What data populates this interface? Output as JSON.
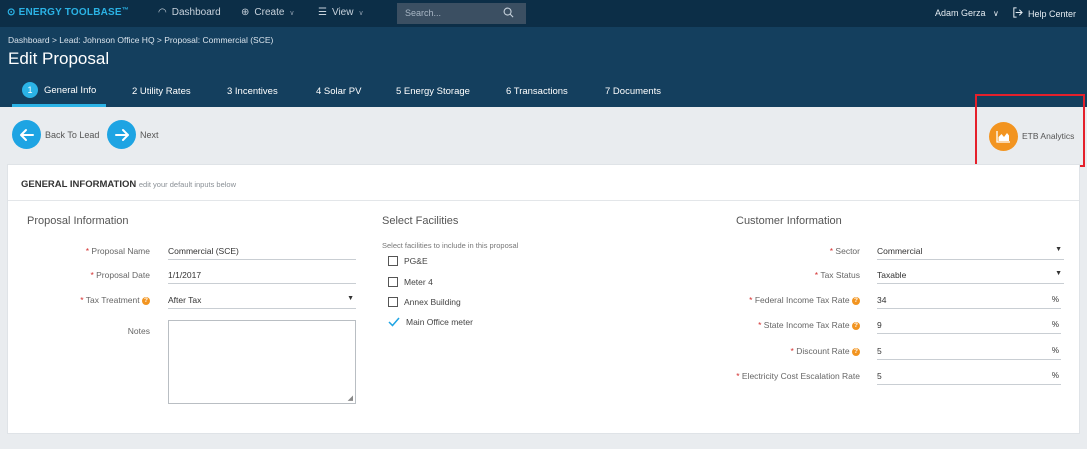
{
  "topnav": {
    "logo": "ENERGY TOOLBASE",
    "logo_tm": "™",
    "dashboard": "Dashboard",
    "create": "Create",
    "view": "View",
    "search_placeholder": "Search...",
    "user": "Adam Gerza",
    "help": "Help Center"
  },
  "header": {
    "breadcrumb": "Dashboard  >  Lead: Johnson Office HQ  >  Proposal: Commercial (SCE)",
    "title": "Edit Proposal",
    "tabs": [
      {
        "num": "1",
        "label": "General Info"
      },
      {
        "label": "2  Utility Rates"
      },
      {
        "label": "3  Incentives"
      },
      {
        "label": "4  Solar PV"
      },
      {
        "label": "5  Energy Storage"
      },
      {
        "label": "6  Transactions"
      },
      {
        "label": "7  Documents"
      }
    ]
  },
  "actions": {
    "back": "Back To Lead",
    "next": "Next",
    "analytics": "ETB Analytics"
  },
  "card": {
    "title": "GENERAL INFORMATION",
    "subtitle": "edit your default inputs below"
  },
  "proposal": {
    "section": "Proposal Information",
    "name_label": "Proposal Name",
    "name_value": "Commercial (SCE)",
    "date_label": "Proposal Date",
    "date_value": "1/1/2017",
    "tax_label": "Tax Treatment",
    "tax_value": "After Tax",
    "notes_label": "Notes"
  },
  "facilities": {
    "section": "Select Facilities",
    "hint": "Select facilities to include in this proposal",
    "items": [
      {
        "label": "PG&E",
        "checked": false
      },
      {
        "label": "Meter 4",
        "checked": false
      },
      {
        "label": "Annex Building",
        "checked": false
      },
      {
        "label": "Main Office meter",
        "checked": true
      }
    ]
  },
  "customer": {
    "section": "Customer Information",
    "sector_label": "Sector",
    "sector_value": "Commercial",
    "tax_status_label": "Tax Status",
    "tax_status_value": "Taxable",
    "federal_label": "Federal Income Tax Rate",
    "federal_value": "34",
    "state_label": "State Income Tax Rate",
    "state_value": "9",
    "discount_label": "Discount Rate",
    "discount_value": "5",
    "escalation_label": "Electricity Cost Escalation Rate",
    "escalation_value": "5",
    "unit": "%"
  },
  "colors": {
    "nav_bg": "#0c2e47",
    "header_bg": "#143f5e",
    "accent_blue": "#1ea4e3",
    "accent_orange": "#f29420",
    "highlight_red": "#e5202b"
  }
}
